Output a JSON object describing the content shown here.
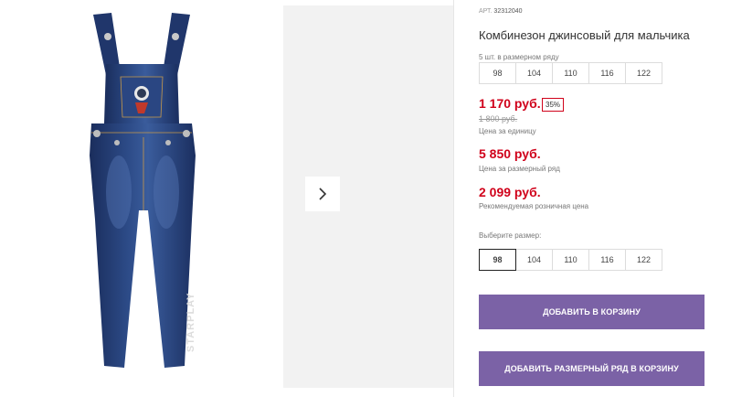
{
  "gallery": {
    "next_icon": "chevron-right-icon",
    "print_text": "STARPLAY"
  },
  "product": {
    "art_label": "АРТ.",
    "art_number": "32312040",
    "title": "Комбинезон джинсовый для мальчика",
    "pack_note": "5 шт. в размерном ряду",
    "pack_sizes": [
      "98",
      "104",
      "110",
      "116",
      "122"
    ],
    "price": "1 170 руб.",
    "discount": "35%",
    "old_price": "1 800 руб.",
    "unit_price_label": "Цена за единицу",
    "pack_price": "5 850 руб.",
    "pack_price_label": "Цена за размерный ряд",
    "retail_price": "2 099 руб.",
    "retail_price_label": "Рекомендуемая розничная цена",
    "choose_size_label": "Выберите размер:",
    "sizes": [
      "98",
      "104",
      "110",
      "116",
      "122"
    ],
    "selected_size": "98"
  },
  "actions": {
    "add_to_cart": "ДОБАВИТЬ В КОРЗИНУ",
    "add_pack_to_cart": "ДОБАВИТЬ РАЗМЕРНЫЙ РЯД В КОРЗИНУ"
  },
  "colors": {
    "accent": "#7b62a6",
    "price": "#d0021b"
  }
}
